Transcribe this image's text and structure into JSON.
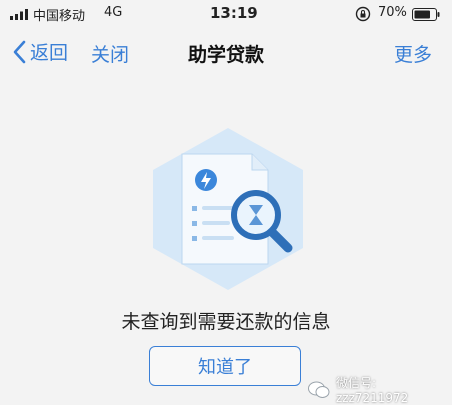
{
  "status_bar": {
    "carrier": "中国移动",
    "network": "4G",
    "time": "13:19",
    "battery_percent": "70%"
  },
  "nav": {
    "back_label": "返回",
    "close_label": "关闭",
    "title": "助学贷款",
    "more_label": "更多"
  },
  "content": {
    "illustration_icon": "document-search-icon",
    "message": "未查询到需要还款的信息",
    "button_label": "知道了"
  },
  "watermark": {
    "text": "微信号: zzz7211972"
  },
  "colors": {
    "accent": "#3a7fd6",
    "hexagon": "#d6e8f8",
    "background": "#f3f3f3"
  }
}
